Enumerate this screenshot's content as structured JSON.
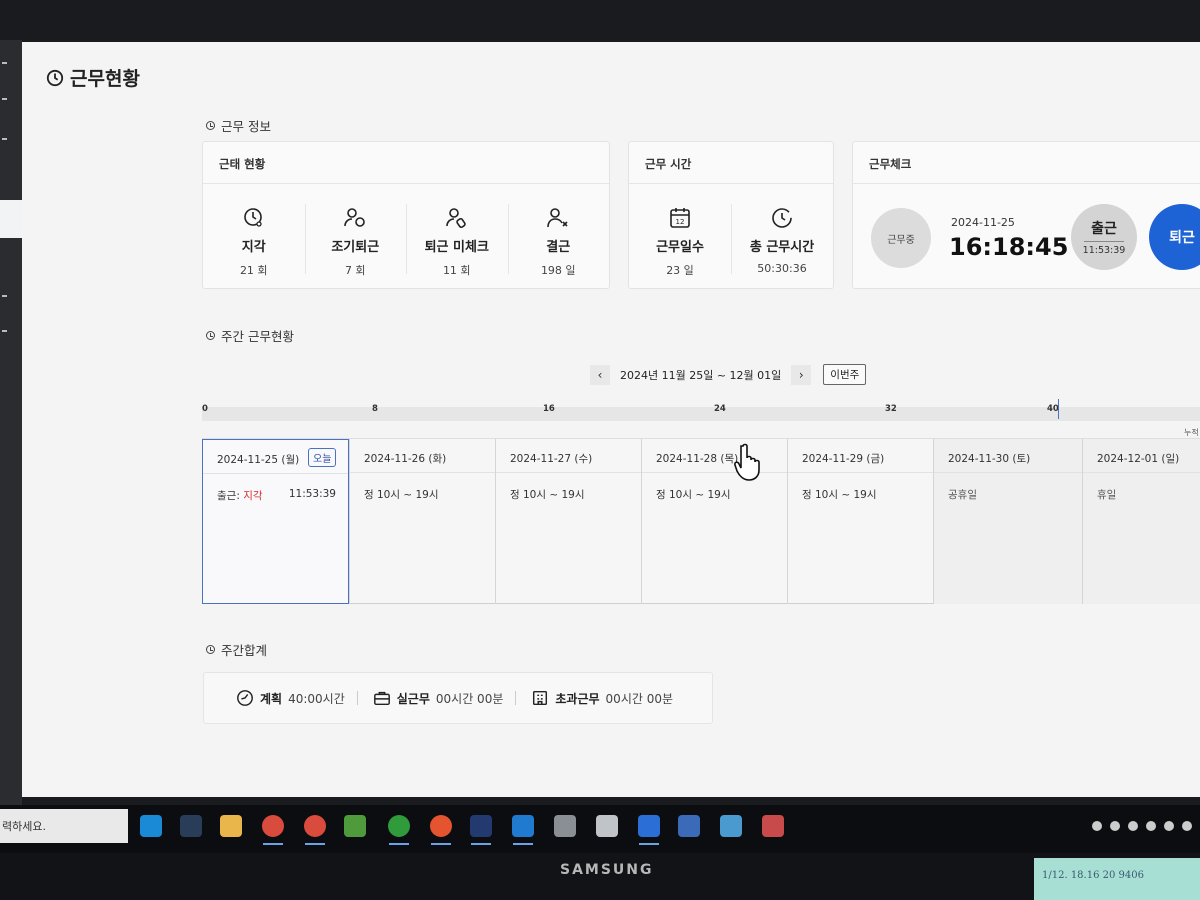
{
  "page": {
    "title": "근무현황"
  },
  "work_info": {
    "section_title": "근무 정보",
    "attendance": {
      "title": "근태 현황",
      "items": [
        {
          "label": "지각",
          "value": "21 회",
          "icon": "clock-user-icon"
        },
        {
          "label": "조기퇴근",
          "value": "7 회",
          "icon": "user-clock-icon"
        },
        {
          "label": "퇴근 미체크",
          "value": "11 회",
          "icon": "user-tag-icon"
        },
        {
          "label": "결근",
          "value": "198 일",
          "icon": "user-x-icon"
        }
      ]
    },
    "work_time": {
      "title": "근무 시간",
      "items": [
        {
          "label": "근무일수",
          "value": "23 일",
          "icon": "calendar-icon",
          "icon_text": "12"
        },
        {
          "label": "총 근무시간",
          "value": "50:30:36",
          "icon": "clock-icon"
        }
      ]
    },
    "work_check": {
      "title": "근무체크",
      "status": "근무중",
      "date": "2024-11-25",
      "time": "16:18:45",
      "clock_in_label": "출근",
      "clock_in_time": "11:53:39",
      "clock_out_label": "퇴근"
    }
  },
  "weekly": {
    "section_title": "주간 근무현황",
    "range": "2024년 11월 25일 ~ 12월 01일",
    "this_week_label": "이번주",
    "timeline_ticks": [
      "0",
      "8",
      "16",
      "24",
      "32",
      "40"
    ],
    "timeline_end_label": "누적",
    "today_badge": "오늘",
    "days": [
      {
        "date": "2024-11-25 (월)",
        "status_label": "출근: ",
        "status_value": "지각",
        "time": "11:53:39",
        "today": true
      },
      {
        "date": "2024-11-26 (화)",
        "schedule": "정 10시 ~ 19시"
      },
      {
        "date": "2024-11-27 (수)",
        "schedule": "정 10시 ~ 19시"
      },
      {
        "date": "2024-11-28 (목)",
        "schedule": "정 10시 ~ 19시"
      },
      {
        "date": "2024-11-29 (금)",
        "schedule": "정 10시 ~ 19시"
      },
      {
        "date": "2024-11-30 (토)",
        "schedule": "공휴일"
      },
      {
        "date": "2024-12-01 (일)",
        "schedule": "휴일"
      }
    ]
  },
  "weekly_total": {
    "section_title": "주간합계",
    "items": [
      {
        "label": "계획",
        "value": "40:00시간",
        "icon": "gauge-icon"
      },
      {
        "label": "실근무",
        "value": "00시간 00분",
        "icon": "briefcase-icon"
      },
      {
        "label": "초과근무",
        "value": "00시간 00분",
        "icon": "building-icon"
      }
    ]
  },
  "taskbar": {
    "search_text": "력하세요."
  },
  "monitor": {
    "brand": "SAMSUNG"
  },
  "sticky_note": {
    "text": "1/12. 18.16 20 9406"
  },
  "colors": {
    "accent_blue": "#1e63d6",
    "late_red": "#d62b2b",
    "today_border": "#4a72c2"
  }
}
